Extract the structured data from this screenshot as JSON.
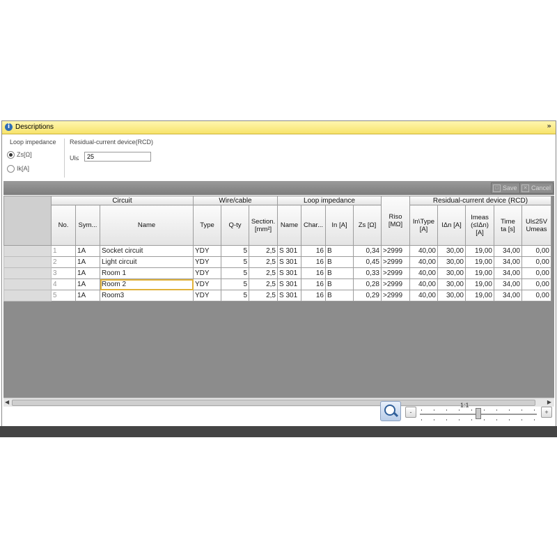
{
  "window": {
    "title": "Descriptions"
  },
  "options": {
    "loop_title": "Loop impedance",
    "radio_zs": "Zs[Ω]",
    "radio_ik": "Ik[A]",
    "rcd_title": "Residual-current device(RCD)",
    "ul_label": "Ul≤",
    "ul_value": "25"
  },
  "toolbar": {
    "save_label": "Save",
    "cancel_label": "Cancel"
  },
  "grid": {
    "groups": {
      "circuit": "Circuit",
      "wire": "Wire/cable",
      "loop": "Loop impedance",
      "rcd": "Residual-current device (RCD)"
    },
    "columns": {
      "no": "No.",
      "sym": "Sym...",
      "name": "Name",
      "type": "Type",
      "qty": "Q-ty",
      "section": "Section.\n[mm²]",
      "pname": "Name",
      "char": "Char...",
      "in": "In [A]",
      "zs": "Zs [Ω]",
      "riso": "Riso\n[MΩ]",
      "intype": "In\\Type\n[A]",
      "idn": "IΔn [A]",
      "imeas": "Imeas\n(≤IΔn)\n[A]",
      "time": "Time\nta [s]",
      "umeas": "Ul≤25V\nUmeas"
    },
    "rows": [
      {
        "no": "1",
        "sym": "1A",
        "name": "Socket circuit",
        "type": "YDY",
        "qty": "5",
        "section": "2,5",
        "pname": "S 301",
        "char": "16",
        "in": "B",
        "zs": "0,34",
        "riso": ">2999",
        "intype": "40,00",
        "idn": "30,00",
        "imeas": "19,00",
        "time": "34,00",
        "umeas": "0,00"
      },
      {
        "no": "2",
        "sym": "1A",
        "name": "Light circuit",
        "type": "YDY",
        "qty": "5",
        "section": "2,5",
        "pname": "S 301",
        "char": "16",
        "in": "B",
        "zs": "0,45",
        "riso": ">2999",
        "intype": "40,00",
        "idn": "30,00",
        "imeas": "19,00",
        "time": "34,00",
        "umeas": "0,00"
      },
      {
        "no": "3",
        "sym": "1A",
        "name": "Room 1",
        "type": "YDY",
        "qty": "5",
        "section": "2,5",
        "pname": "S 301",
        "char": "16",
        "in": "B",
        "zs": "0,33",
        "riso": ">2999",
        "intype": "40,00",
        "idn": "30,00",
        "imeas": "19,00",
        "time": "34,00",
        "umeas": "0,00"
      },
      {
        "no": "4",
        "sym": "1A",
        "name": "Room 2",
        "type": "YDY",
        "qty": "5",
        "section": "2,5",
        "pname": "S 301",
        "char": "16",
        "in": "B",
        "zs": "0,28",
        "riso": ">2999",
        "intype": "40,00",
        "idn": "30,00",
        "imeas": "19,00",
        "time": "34,00",
        "umeas": "0,00"
      },
      {
        "no": "5",
        "sym": "1A",
        "name": "Room3",
        "type": "YDY",
        "qty": "5",
        "section": "2,5",
        "pname": "S 301",
        "char": "16",
        "in": "B",
        "zs": "0,29",
        "riso": ">2999",
        "intype": "40,00",
        "idn": "30,00",
        "imeas": "19,00",
        "time": "34,00",
        "umeas": "0,00"
      }
    ],
    "selected_row": 3
  },
  "zoom": {
    "label": "1:1",
    "minus": "-",
    "plus": "+"
  }
}
